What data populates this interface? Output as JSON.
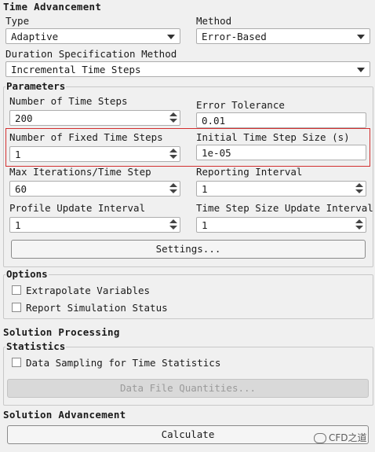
{
  "time_advancement": {
    "title": "Time Advancement",
    "type_label": "Type",
    "type_value": "Adaptive",
    "method_label": "Method",
    "method_value": "Error-Based",
    "duration_label": "Duration Specification Method",
    "duration_value": "Incremental Time Steps"
  },
  "parameters": {
    "title": "Parameters",
    "num_time_steps_label": "Number of Time Steps",
    "num_time_steps_value": "200",
    "error_tolerance_label": "Error Tolerance",
    "error_tolerance_value": "0.01",
    "num_fixed_steps_label": "Number of Fixed Time Steps",
    "num_fixed_steps_value": "1",
    "initial_step_size_label": "Initial Time Step Size (s)",
    "initial_step_size_value": "1e-05",
    "max_iter_label": "Max Iterations/Time Step",
    "max_iter_value": "60",
    "reporting_label": "Reporting Interval",
    "reporting_value": "1",
    "profile_update_label": "Profile Update Interval",
    "profile_update_value": "1",
    "step_update_label": "Time Step Size Update Interval",
    "step_update_value": "1",
    "settings_button": "Settings..."
  },
  "options": {
    "title": "Options",
    "extrapolate_label": "Extrapolate Variables",
    "report_status_label": "Report Simulation Status"
  },
  "solution_processing": {
    "title": "Solution Processing",
    "statistics_title": "Statistics",
    "data_sampling_label": "Data Sampling for Time Statistics",
    "data_file_button": "Data File Quantities..."
  },
  "solution_advancement": {
    "title": "Solution Advancement",
    "calculate_button": "Calculate"
  },
  "watermark": "CFD之道"
}
